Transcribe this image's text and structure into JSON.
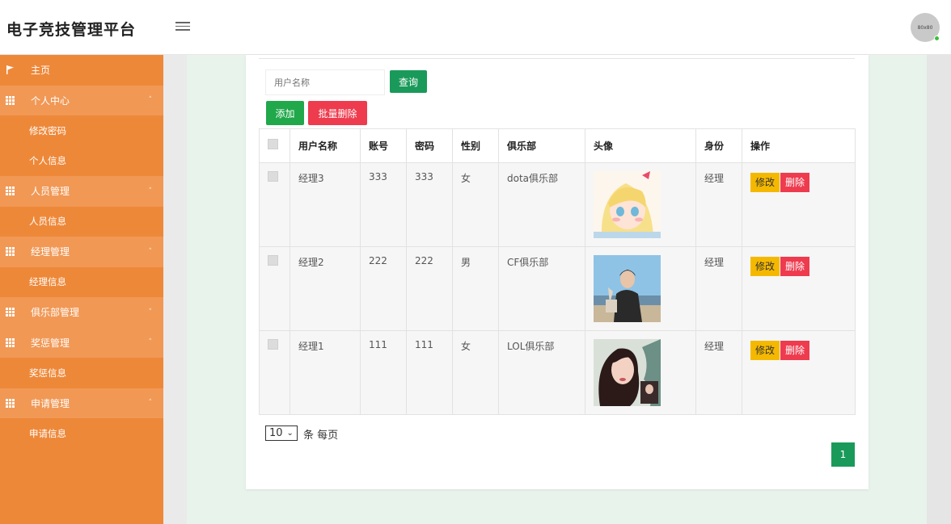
{
  "header": {
    "title": "电子竞技管理平台",
    "menu_icon": "hamburger-icon",
    "avatar_text": "80x80"
  },
  "sidebar": {
    "items": [
      {
        "type": "home",
        "label": "主页",
        "icon": "flag-icon"
      },
      {
        "type": "section",
        "label": "个人中心",
        "icon": "grid-icon",
        "caret": "˄"
      },
      {
        "type": "sub",
        "label": "修改密码"
      },
      {
        "type": "sub",
        "label": "个人信息"
      },
      {
        "type": "section",
        "label": "人员管理",
        "icon": "grid-icon",
        "caret": "˄"
      },
      {
        "type": "sub",
        "label": "人员信息"
      },
      {
        "type": "section",
        "label": "经理管理",
        "icon": "grid-icon",
        "caret": "˄"
      },
      {
        "type": "sub",
        "label": "经理信息"
      },
      {
        "type": "section",
        "label": "俱乐部管理",
        "icon": "grid-icon",
        "caret": "˅"
      },
      {
        "type": "section",
        "label": "奖惩管理",
        "icon": "grid-icon",
        "caret": "˄"
      },
      {
        "type": "sub",
        "label": "奖惩信息"
      },
      {
        "type": "section",
        "label": "申请管理",
        "icon": "grid-icon",
        "caret": "˄"
      },
      {
        "type": "sub",
        "label": "申请信息"
      }
    ]
  },
  "toolbar": {
    "search_placeholder": "用户名称",
    "search_label": "查询",
    "add_label": "添加",
    "bulk_delete_label": "批量删除"
  },
  "table": {
    "headers": [
      "用户名称",
      "账号",
      "密码",
      "性别",
      "俱乐部",
      "头像",
      "身份",
      "操作"
    ],
    "rows": [
      {
        "name": "经理3",
        "account": "333",
        "password": "333",
        "gender": "女",
        "club": "dota俱乐部",
        "role": "经理",
        "avatar": "anime-girl-avatar"
      },
      {
        "name": "经理2",
        "account": "222",
        "password": "222",
        "gender": "男",
        "club": "CF俱乐部",
        "role": "经理",
        "avatar": "young-man-photo-avatar"
      },
      {
        "name": "经理1",
        "account": "111",
        "password": "111",
        "gender": "女",
        "club": "LOL俱乐部",
        "role": "经理",
        "avatar": "painted-woman-avatar"
      }
    ],
    "edit_label": "修改",
    "delete_label": "删除"
  },
  "pagination": {
    "page_size": "10",
    "page_size_suffix": "条 每页",
    "current_page": "1"
  },
  "colors": {
    "sidebar": "#ee8839",
    "sidebar_section": "#f19855",
    "primary_green": "#1a9a5a",
    "add_green": "#20a84a",
    "danger": "#ee3b4e",
    "warning": "#f5b800",
    "main_bg": "#e8f3ec"
  }
}
